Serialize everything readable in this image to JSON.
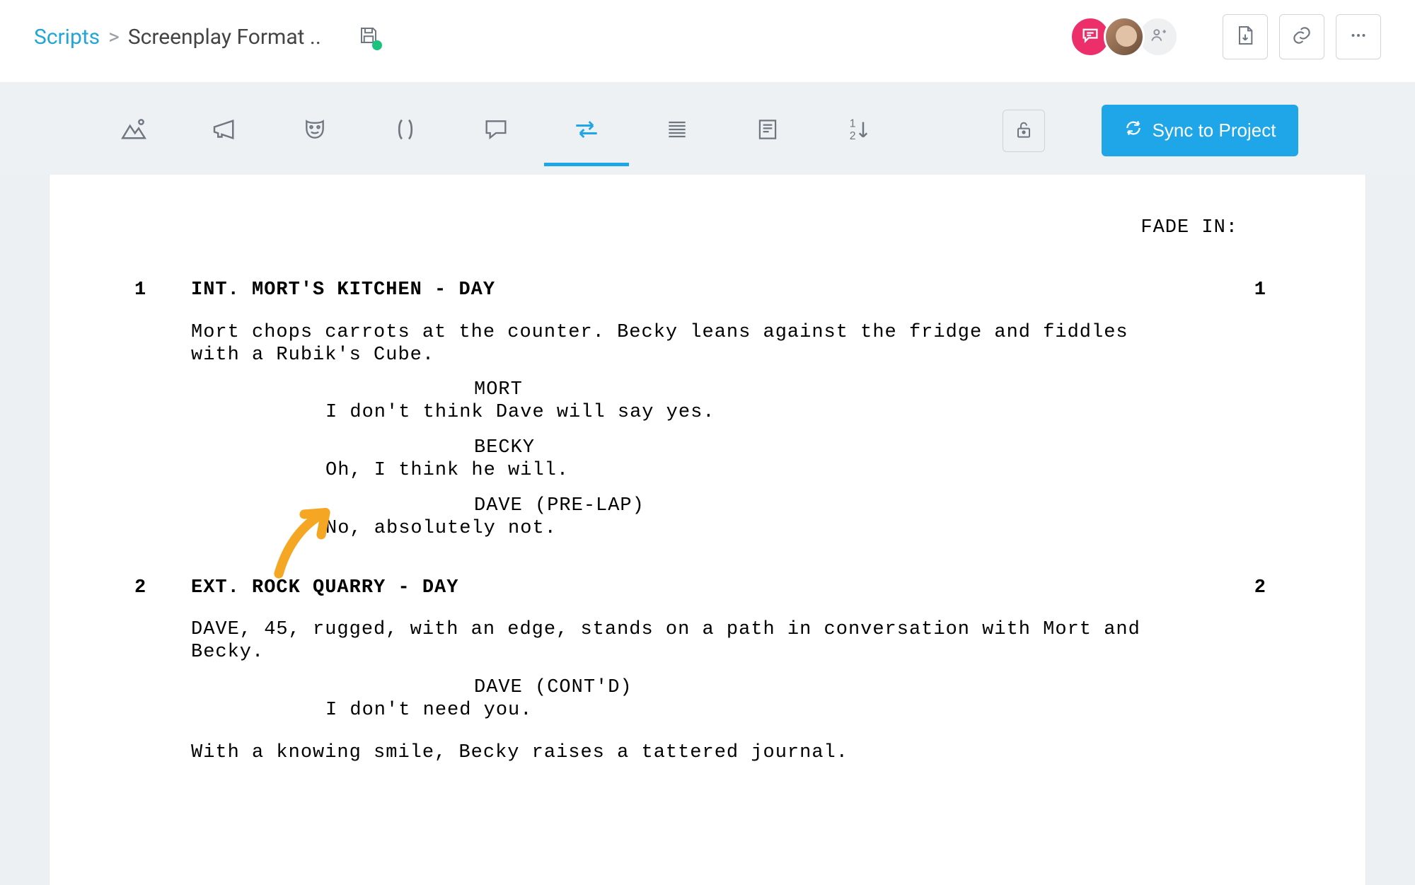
{
  "breadcrumb": {
    "root": "Scripts",
    "current": "Screenplay Format ..",
    "separator": ">"
  },
  "header_buttons": {
    "sync_label": "Sync to Project"
  },
  "colors": {
    "accent": "#1ea6e8",
    "comment_pink": "#ec2f6a",
    "save_green": "#1bc47d"
  },
  "script": {
    "transition_in": "FADE IN:",
    "scenes": [
      {
        "number": "1",
        "heading": "INT. MORT'S KITCHEN - DAY",
        "blocks": [
          {
            "type": "action",
            "text": "Mort chops carrots at the counter. Becky leans against the fridge and fiddles with a Rubik's Cube."
          },
          {
            "type": "character",
            "text": "MORT"
          },
          {
            "type": "dialogue",
            "text": "I don't think Dave will say yes."
          },
          {
            "type": "character",
            "text": "BECKY"
          },
          {
            "type": "dialogue",
            "text": "Oh, I think he will."
          },
          {
            "type": "character",
            "text": "DAVE (PRE-LAP)"
          },
          {
            "type": "dialogue",
            "text": "No, absolutely not."
          }
        ]
      },
      {
        "number": "2",
        "heading": "EXT. ROCK QUARRY - DAY",
        "blocks": [
          {
            "type": "action",
            "text": "DAVE, 45, rugged, with an edge, stands on a path in conversation with Mort and Becky."
          },
          {
            "type": "character",
            "text": "DAVE (CONT'D)"
          },
          {
            "type": "dialogue",
            "text": "I don't need you."
          },
          {
            "type": "action",
            "text": "With a knowing smile, Becky raises a tattered journal."
          }
        ]
      }
    ]
  }
}
